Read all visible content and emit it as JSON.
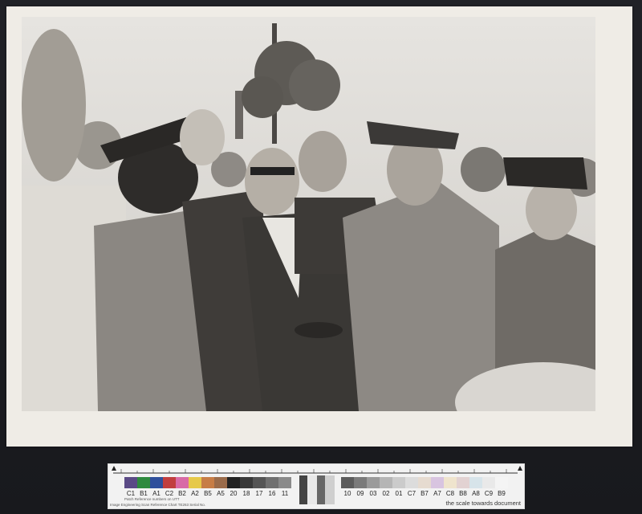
{
  "photo": {
    "subject": "photograph",
    "tone": "black-and-white"
  },
  "color_target": {
    "color_labels": [
      "C1",
      "B1",
      "A1",
      "C2",
      "B2",
      "A2",
      "B5",
      "A5",
      "20",
      "18",
      "17",
      "16",
      "11"
    ],
    "gray_labels": [
      "10",
      "09",
      "03",
      "02",
      "01",
      "C7",
      "B7",
      "A7",
      "C8",
      "B8",
      "A8",
      "C9",
      "B9"
    ],
    "reference_line1": "Patch Reference numbers on UTT",
    "reference_line2": "Image Engineering   Scan Reference Chart   TE263   Serial No.",
    "scale_note": "the scale towards document"
  }
}
